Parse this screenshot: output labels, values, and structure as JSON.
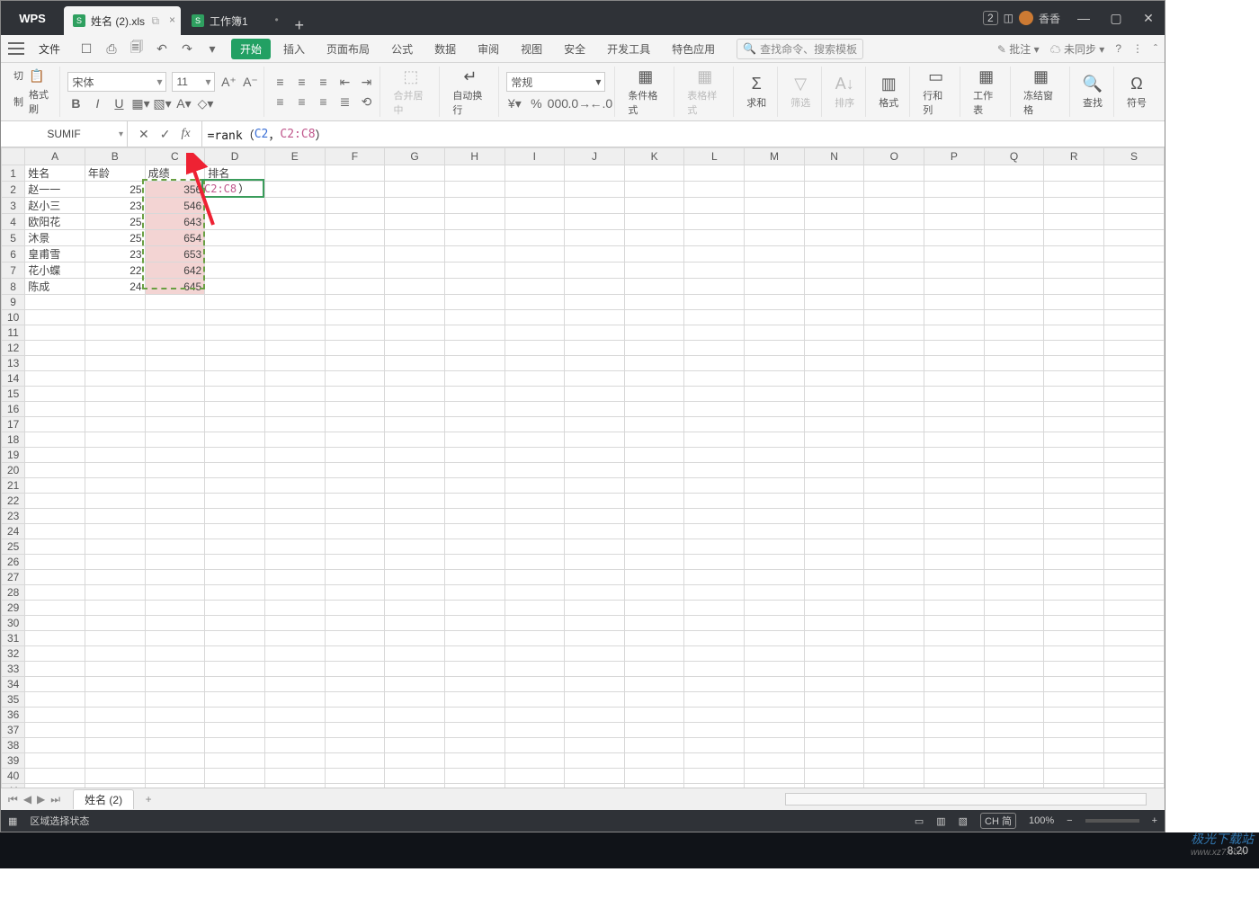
{
  "app": {
    "name": "WPS"
  },
  "tabs": [
    {
      "label": "姓名 (2).xls",
      "active": true
    },
    {
      "label": "工作簿1",
      "active": false
    }
  ],
  "account": {
    "name": "香香",
    "msg_count": "2"
  },
  "window_controls": {
    "min": "—",
    "max": "▢",
    "close": "✕"
  },
  "menubar": {
    "file": "文件",
    "items": [
      "开始",
      "插入",
      "页面布局",
      "公式",
      "数据",
      "审阅",
      "视图",
      "安全",
      "开发工具",
      "特色应用"
    ],
    "active": "开始",
    "search_placeholder": "查找命令、搜索模板",
    "right": {
      "annotate": "批注",
      "sync": "未同步"
    }
  },
  "toolbar": {
    "clipboard": {
      "cut": "切",
      "copy": "制",
      "painter": "格式刷"
    },
    "font": {
      "name": "宋体",
      "size": "11"
    },
    "number_format": "常规",
    "merge": "合并居中",
    "wrap": "自动换行",
    "cond_fmt": "条件格式",
    "table_fmt": "表格样式",
    "sum": "求和",
    "filter": "筛选",
    "sort": "排序",
    "format": "格式",
    "rowscols": "行和列",
    "worksheet": "工作表",
    "freeze": "冻结窗格",
    "find": "查找",
    "symbol": "符号"
  },
  "namebox": "SUMIF",
  "formula": {
    "prefix": "=rank（",
    "arg1": "C2",
    "sep": "，",
    "arg2": "C2:C8",
    "suffix": "）"
  },
  "columns": [
    "A",
    "B",
    "C",
    "D",
    "E",
    "F",
    "G",
    "H",
    "I",
    "J",
    "K",
    "L",
    "M",
    "N",
    "O",
    "P",
    "Q",
    "R",
    "S"
  ],
  "headers": {
    "A": "姓名",
    "B": "年龄",
    "C": "成绩",
    "D": "排名"
  },
  "rows": [
    {
      "name": "赵一一",
      "age": "25",
      "score": "356"
    },
    {
      "name": "赵小三",
      "age": "23",
      "score": "546"
    },
    {
      "name": "欧阳花",
      "age": "25",
      "score": "643"
    },
    {
      "name": "沐景",
      "age": "25",
      "score": "654"
    },
    {
      "name": "皇甫雪",
      "age": "23",
      "score": "653"
    },
    {
      "name": "花小蝶",
      "age": "22",
      "score": "642"
    },
    {
      "name": "陈成",
      "age": "24",
      "score": "645"
    }
  ],
  "cell_overlay": {
    "range": "C2:C8",
    "paren": "）"
  },
  "sheet_tabs": {
    "active": "姓名 (2)"
  },
  "statusbar": {
    "mode": "区域选择状态",
    "zoom": "100%",
    "ime": "CH 简"
  },
  "watermark": {
    "line1": "极光下载站",
    "line2": "www.xz7.com"
  },
  "clock": "8:20",
  "chart_data": null
}
